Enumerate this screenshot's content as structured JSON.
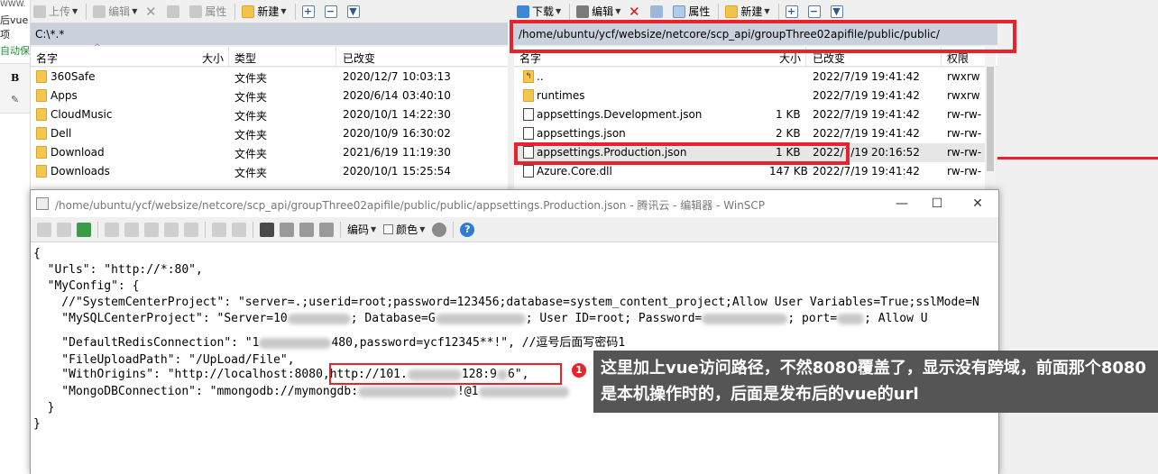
{
  "background_strip": {
    "line1": "WWW.",
    "line2": "后vue项",
    "line3": "自动保",
    "bold_btn": "B"
  },
  "left_toolbar": {
    "upload": "上传",
    "edit": "编辑",
    "properties": "属性",
    "new": "新建"
  },
  "right_toolbar": {
    "download": "下载",
    "edit": "编辑",
    "properties": "属性",
    "new": "新建"
  },
  "left_panel": {
    "path": "C:\\*.*",
    "columns": {
      "name": "名字",
      "size": "大小",
      "type": "类型",
      "modified": "已改变"
    },
    "rows": [
      {
        "name": "360Safe",
        "type": "文件夹",
        "date": "2020/12/7",
        "time": "10:03:13"
      },
      {
        "name": "Apps",
        "type": "文件夹",
        "date": "2020/6/14",
        "time": "03:40:10"
      },
      {
        "name": "CloudMusic",
        "type": "文件夹",
        "date": "2020/10/1",
        "time": "14:22:30"
      },
      {
        "name": "Dell",
        "type": "文件夹",
        "date": "2020/10/9",
        "time": "16:30:02"
      },
      {
        "name": "Download",
        "type": "文件夹",
        "date": "2021/6/19",
        "time": "11:19:30"
      },
      {
        "name": "Downloads",
        "type": "文件夹",
        "date": "2020/10/1",
        "time": "15:25:54"
      }
    ]
  },
  "right_panel": {
    "path": "/home/ubuntu/ycf/websize/netcore/scp_api/groupThree02apifile/public/public/",
    "columns": {
      "name": "名字",
      "size": "大小",
      "modified": "已改变",
      "perms": "权限"
    },
    "rows": [
      {
        "name": "..",
        "size": "",
        "date": "2022/7/19",
        "time": "19:41:42",
        "perms": "rwxrw",
        "icon": "up"
      },
      {
        "name": "runtimes",
        "size": "",
        "date": "2022/7/19",
        "time": "19:41:42",
        "perms": "rwxrw",
        "icon": "folder"
      },
      {
        "name": "appsettings.Development.json",
        "size": "1 KB",
        "date": "2022/7/19",
        "time": "19:41:42",
        "perms": "rw-rw-",
        "icon": "file"
      },
      {
        "name": "appsettings.json",
        "size": "2 KB",
        "date": "2022/7/19",
        "time": "19:41:42",
        "perms": "rw-rw-",
        "icon": "file"
      },
      {
        "name": "appsettings.Production.json",
        "size": "1 KB",
        "date": "2022/7/19",
        "time": "20:16:52",
        "perms": "rw-rw-",
        "icon": "file"
      },
      {
        "name": "Azure.Core.dll",
        "size": "147 KB",
        "date": "2022/7/19",
        "time": "19:41:42",
        "perms": "rw-rw-",
        "icon": "file"
      }
    ]
  },
  "editor": {
    "title": "/home/ubuntu/ycf/websize/netcore/scp_api/groupThree02apifile/public/public/appsettings.Production.json - 腾讯云 - 编辑器 - WinSCP",
    "encoding_label": "编码",
    "color_label": "颜色",
    "lines": {
      "l1": "{",
      "l2": "  \"Urls\": \"http://*:80\",",
      "l3": "  \"MyConfig\": {",
      "l4": "    //\"SystemCenterProject\": \"server=.;userid=root;password=123456;database=system_content_project;Allow User Variables=True;sslMode=N",
      "l5a": "    \"MySQLCenterProject\": \"Server=10",
      "l5b": "; Database=G",
      "l5c": "; User ID=root; Password=",
      "l5d": "; port=",
      "l5e": "; Allow U",
      "l6a": "    \"DefaultRedisConnection\": \"1",
      "l6b": "480,password=ycf12345**!\", //逗号后面写密码1",
      "l7": "    \"FileUploadPath\": \"/UpLoad/File\",",
      "l8a": "    \"WithOrigins\": \"http://localhost:8080",
      "l8b": ",http://101.",
      "l8c": "128:9",
      "l8d": "6\",",
      "l9a": "    \"MongoDBConnection\": \"mmongodb://mymongdb:",
      "l9b": "!@1",
      "l10": "  }",
      "l11": "}"
    }
  },
  "callout": {
    "number": "1",
    "text": "这里加上vue访问路径，不然8080覆盖了，显示没有跨域，前面那个8080是本机操作时的，后面是发布后的vue的url"
  },
  "colors": {
    "annotation_red": "#e8232c",
    "callout_bg": "#555555",
    "pathbar": "#c9d2dc"
  }
}
